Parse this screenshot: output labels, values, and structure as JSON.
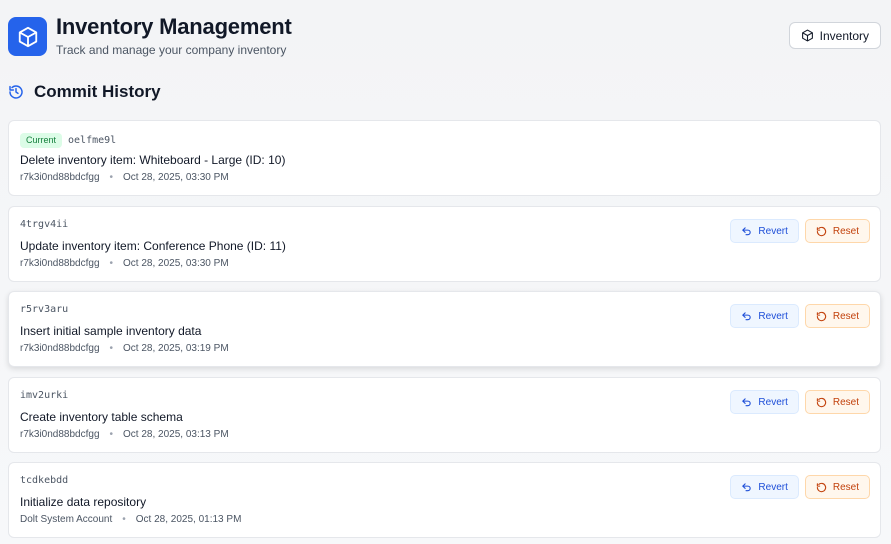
{
  "header": {
    "title": "Inventory Management",
    "subtitle": "Track and manage your company inventory",
    "logo_icon": "box-icon",
    "inventory_button_label": "Inventory"
  },
  "section": {
    "title": "Commit History",
    "icon": "history-icon"
  },
  "actions": {
    "revert_label": "Revert",
    "reset_label": "Reset"
  },
  "commits": [
    {
      "badge": "Current",
      "hash": "oelfme9l",
      "message": "Delete inventory item: Whiteboard - Large (ID: 10)",
      "author": "r7k3i0nd88bdcfgg",
      "date": "Oct 28, 2025, 03:30 PM"
    },
    {
      "hash": "4trgv4ii",
      "message": "Update inventory item: Conference Phone (ID: 11)",
      "author": "r7k3i0nd88bdcfgg",
      "date": "Oct 28, 2025, 03:30 PM"
    },
    {
      "hash": "r5rv3aru",
      "message": "Insert initial sample inventory data",
      "author": "r7k3i0nd88bdcfgg",
      "date": "Oct 28, 2025, 03:19 PM"
    },
    {
      "hash": "imv2urki",
      "message": "Create inventory table schema",
      "author": "r7k3i0nd88bdcfgg",
      "date": "Oct 28, 2025, 03:13 PM"
    },
    {
      "hash": "tcdkebdd",
      "message": "Initialize data repository",
      "author": "Dolt System Account",
      "date": "Oct 28, 2025, 01:13 PM"
    }
  ],
  "colors": {
    "accent": "#2563eb",
    "revert": "#1d4ed8",
    "reset": "#c2410c",
    "current_badge": "#15803d"
  }
}
